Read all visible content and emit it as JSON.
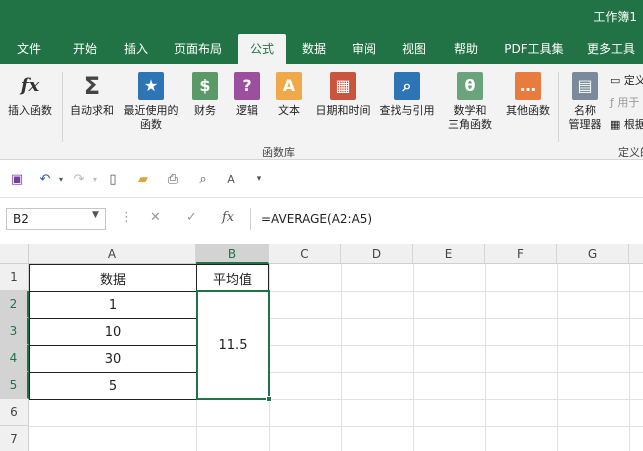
{
  "window": {
    "title": "工作簿1"
  },
  "tabs": [
    "文件",
    "开始",
    "插入",
    "页面布局",
    "公式",
    "数据",
    "审阅",
    "视图",
    "帮助",
    "PDF工具集",
    "更多工具"
  ],
  "active_tab_index": 4,
  "ribbon": {
    "buttons": [
      {
        "label1": "插入函数",
        "label2": "",
        "icon": "function-icon",
        "glyph": "fx"
      },
      {
        "label1": "自动求和",
        "label2": "",
        "icon": "sum-icon",
        "glyph": "Σ"
      },
      {
        "label1": "最近使用的",
        "label2": "函数",
        "icon": "star-icon",
        "glyph": "★"
      },
      {
        "label1": "财务",
        "label2": "",
        "icon": "coins-icon",
        "glyph": "$"
      },
      {
        "label1": "逻辑",
        "label2": "",
        "icon": "question-icon",
        "glyph": "?"
      },
      {
        "label1": "文本",
        "label2": "",
        "icon": "text-icon",
        "glyph": "A"
      },
      {
        "label1": "日期和时间",
        "label2": "",
        "icon": "calendar-icon",
        "glyph": "▦"
      },
      {
        "label1": "查找与引用",
        "label2": "",
        "icon": "search-icon",
        "glyph": "⌕"
      },
      {
        "label1": "数学和",
        "label2": "三角函数",
        "icon": "theta-icon",
        "glyph": "θ"
      },
      {
        "label1": "其他函数",
        "label2": "",
        "icon": "more-functions-icon",
        "glyph": "…"
      },
      {
        "label1": "名称",
        "label2": "管理器",
        "icon": "name-manager-icon",
        "glyph": "▤"
      }
    ],
    "group_label": "函数库",
    "group_label_right": "定义的",
    "side_items": [
      "定义",
      "用于",
      "根据"
    ]
  },
  "formula_bar": {
    "name_box": "B2",
    "formula": "=AVERAGE(A2:A5)"
  },
  "grid": {
    "columns": [
      "A",
      "B",
      "C",
      "D",
      "E",
      "F",
      "G"
    ],
    "rows": [
      "1",
      "2",
      "3",
      "4",
      "5",
      "6",
      "7"
    ],
    "A1": "数据",
    "B1": "平均值",
    "A2": "1",
    "A3": "10",
    "A4": "30",
    "A5": "5",
    "B2": "11.5"
  },
  "colors": {
    "brand": "#217346",
    "ribbon_bg": "#f3f3f3"
  }
}
